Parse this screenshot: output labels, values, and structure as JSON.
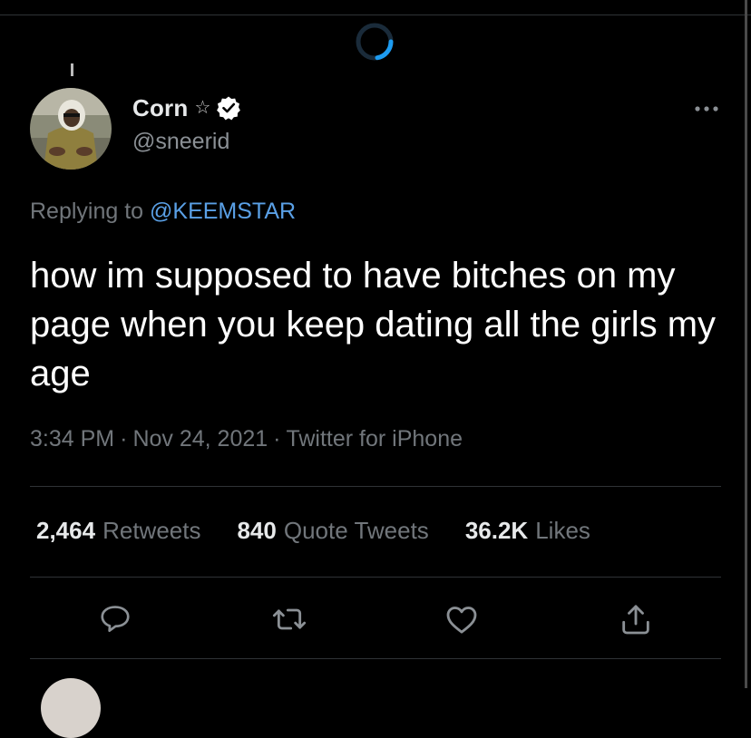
{
  "author": {
    "display_name": "Corn",
    "star_icon": "star-icon",
    "verified_icon": "verified-badge-icon",
    "handle": "@sneerid"
  },
  "reply": {
    "prefix": "Replying to",
    "mention": "@KEEMSTAR"
  },
  "tweet": {
    "text": "how im supposed to have bitches on my page when you keep dating all the girls my age"
  },
  "meta": {
    "time": "3:34 PM",
    "date": "Nov 24, 2021",
    "source": "Twitter for iPhone",
    "separator": "·"
  },
  "stats": {
    "retweets_count": "2,464",
    "retweets_label": "Retweets",
    "quotes_count": "840",
    "quotes_label": "Quote Tweets",
    "likes_count": "36.2K",
    "likes_label": "Likes"
  },
  "actions": [
    "reply-icon",
    "retweet-icon",
    "like-icon",
    "share-icon"
  ],
  "colors": {
    "background": "#000000",
    "text": "#e7e9ea",
    "muted": "#71767b",
    "link": "#5aa0e6",
    "divider": "#2f3336",
    "spinner": "#1d9bf0"
  }
}
